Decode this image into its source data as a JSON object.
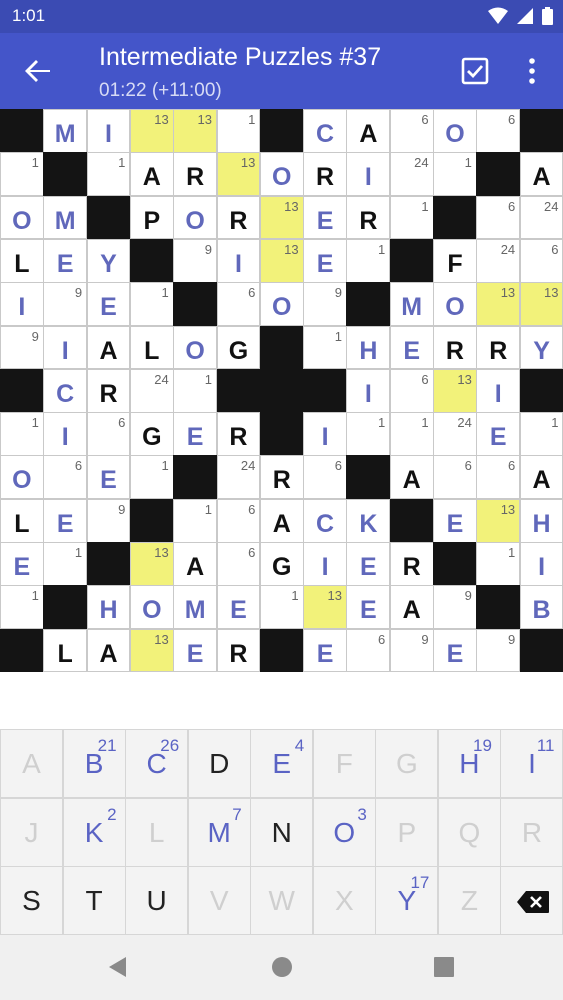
{
  "status": {
    "time": "1:01"
  },
  "appbar": {
    "title": "Intermediate Puzzles #37",
    "timer": "01:22 (+11:00)"
  },
  "grid": [
    [
      "#",
      "M|u",
      "I|u",
      "13|h",
      "13|h",
      "1",
      "#",
      "C|u",
      "A|g",
      "6",
      "O|u",
      "6",
      "#"
    ],
    [
      "1",
      "#",
      "1",
      "A|g",
      "R|g",
      "13|h",
      "O|u",
      "R|g",
      "I|u",
      "24",
      "1",
      "#",
      "A|g"
    ],
    [
      "O|u",
      "M|u",
      "#",
      "P|g",
      "O|u",
      "R|g",
      "13|h",
      "E|u",
      "R|g",
      "1",
      "#",
      "6",
      "24"
    ],
    [
      "L|g",
      "E|u",
      "Y|u",
      "#",
      "9",
      "I|u",
      "13|h",
      "E|u",
      "1",
      "#",
      "F|g",
      "24",
      "6"
    ],
    [
      "I|u",
      "9",
      "E|u",
      "1",
      "#",
      "6",
      "O|u",
      "9",
      "#",
      "M|u",
      "O|u",
      "13|h",
      "13|h"
    ],
    [
      "9",
      "I|u",
      "A|g",
      "L|g",
      "O|u",
      "G|g",
      "#",
      "1",
      "H|u",
      "E|u",
      "R|g",
      "R|g",
      "Y|u"
    ],
    [
      "#",
      "C|u",
      "R|g",
      "24",
      "1",
      "#",
      "#",
      "#",
      "I|u",
      "6",
      "13|h",
      "I|u",
      "#"
    ],
    [
      "1",
      "I|u",
      "6",
      "G|g",
      "E|u",
      "R|g",
      "#",
      "I|u",
      "1",
      "1",
      "24",
      "E|u",
      "1"
    ],
    [
      "O|u",
      "6",
      "E|u",
      "1",
      "#",
      "24",
      "R|g",
      "6",
      "#",
      "A|g",
      "6",
      "6",
      "A|g"
    ],
    [
      "L|g",
      "E|u",
      "9",
      "#",
      "1",
      "6",
      "A|g",
      "C|u",
      "K|u",
      "#",
      "E|u",
      "13|h",
      "H|u"
    ],
    [
      "E|u",
      "1",
      "#",
      "13|h",
      "A|g",
      "6",
      "G|g",
      "I|u",
      "E|u",
      "R|g",
      "#",
      "1",
      "I|u"
    ],
    [
      "1",
      "#",
      "H|u",
      "O|u",
      "M|u",
      "E|u",
      "1",
      "13|h",
      "E|u",
      "A|g",
      "9",
      "#",
      "B|u"
    ],
    [
      "#",
      "L|g",
      "A|g",
      "13|h",
      "E|u",
      "R|g",
      "#",
      "E|u",
      "6",
      "9",
      "E|u",
      "9",
      "#"
    ]
  ],
  "keyboard": {
    "rows": [
      [
        {
          "l": "A",
          "s": "used"
        },
        {
          "l": "B",
          "s": "avail",
          "c": "21"
        },
        {
          "l": "C",
          "s": "avail",
          "c": "26"
        },
        {
          "l": "D",
          "s": "dark"
        },
        {
          "l": "E",
          "s": "avail",
          "c": "4"
        },
        {
          "l": "F",
          "s": "used"
        },
        {
          "l": "G",
          "s": "used"
        },
        {
          "l": "H",
          "s": "avail",
          "c": "19"
        },
        {
          "l": "I",
          "s": "avail",
          "c": "11"
        }
      ],
      [
        {
          "l": "J",
          "s": "used"
        },
        {
          "l": "K",
          "s": "avail",
          "c": "2"
        },
        {
          "l": "L",
          "s": "used"
        },
        {
          "l": "M",
          "s": "avail",
          "c": "7"
        },
        {
          "l": "N",
          "s": "dark"
        },
        {
          "l": "O",
          "s": "avail",
          "c": "3"
        },
        {
          "l": "P",
          "s": "used"
        },
        {
          "l": "Q",
          "s": "used"
        },
        {
          "l": "R",
          "s": "used"
        }
      ],
      [
        {
          "l": "S",
          "s": "dark"
        },
        {
          "l": "T",
          "s": "dark"
        },
        {
          "l": "U",
          "s": "dark"
        },
        {
          "l": "V",
          "s": "used"
        },
        {
          "l": "W",
          "s": "used"
        },
        {
          "l": "X",
          "s": "used"
        },
        {
          "l": "Y",
          "s": "avail",
          "c": "17"
        },
        {
          "l": "Z",
          "s": "used"
        },
        {
          "l": "⌫",
          "s": "backspace"
        }
      ]
    ]
  },
  "icons": {
    "back": "arrow-left-icon",
    "check": "check-box-icon",
    "more": "more-vert-icon",
    "backspace": "backspace-icon"
  },
  "colors": {
    "appbar": "#4455c9",
    "statusbar": "#3b4bb3",
    "highlight": "#f2f27a",
    "user_letter": "#6068bb",
    "key_available": "#5a63c4"
  }
}
